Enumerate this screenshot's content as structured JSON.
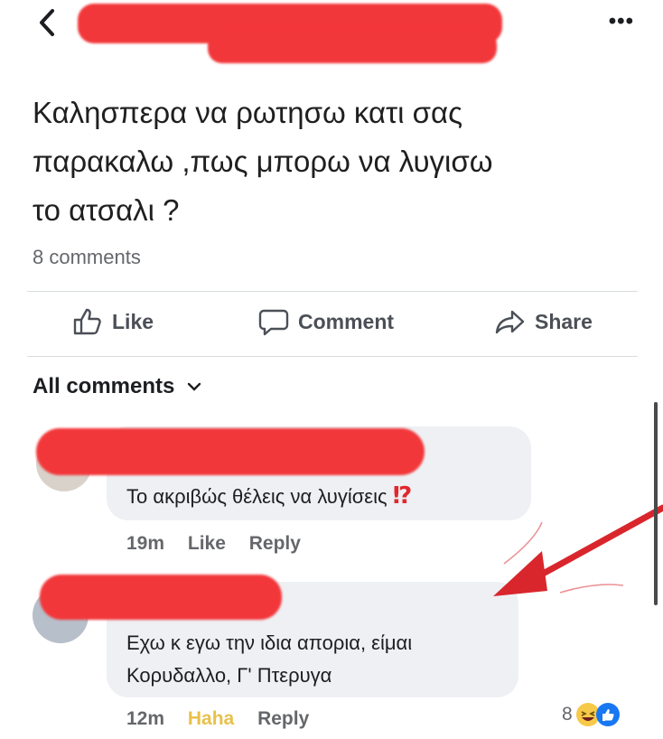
{
  "header": {
    "back_icon": "chevron-left-icon",
    "more_icon": "more-dots-icon",
    "more_glyph": "•••"
  },
  "post": {
    "lines": [
      "Καλησπερα να ρωτησω κατι σας",
      "παρακαλω ,πως μπορω να λυγισω",
      "το ατσαλι ?"
    ],
    "comments_count": "8 comments"
  },
  "actions": {
    "like": "Like",
    "comment": "Comment",
    "share": "Share"
  },
  "comments_section": {
    "filter_label": "All comments"
  },
  "comments": [
    {
      "text": "Το ακριβώς θέλεις να λυγίσεις",
      "emphasis": "⁉",
      "time": "19m",
      "like": "Like",
      "reply": "Reply"
    },
    {
      "text_line1": "Εχω κ εγω την ιδια απορια, είμαι",
      "text_line2": "Κορυδαλλο, Γ' Πτερυγα",
      "time": "12m",
      "reaction_label": "Haha",
      "reply": "Reply",
      "reaction_count": "8"
    }
  ],
  "colors": {
    "redaction": "#f2373a",
    "arrow": "#d9262c",
    "bubble": "#eef0f3",
    "meta": "#65676b",
    "haha": "#e8c14a"
  }
}
